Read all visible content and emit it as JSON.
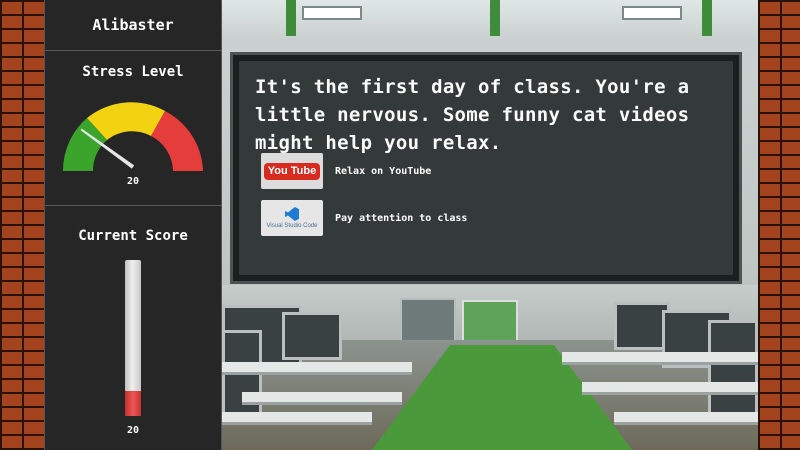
{
  "player": {
    "name": "Alibaster"
  },
  "stress": {
    "title": "Stress Level",
    "value": "20",
    "level_fraction": 0.2
  },
  "score": {
    "title": "Current Score",
    "value": "20",
    "fill_fraction": 0.16
  },
  "story": {
    "text": "It's the first day of class. You're a little nervous. Some funny cat videos might help you relax."
  },
  "choices": [
    {
      "label": "Relax on YouTube",
      "logo": "youtube-logo",
      "logo_text": "You Tube"
    },
    {
      "label": "Pay attention to class",
      "logo": "visual-studio-code-logo",
      "logo_text": "Visual Studio Code"
    }
  ],
  "colors": {
    "gauge_green": "#3aa42b",
    "gauge_yellow": "#f1d312",
    "gauge_red": "#e53c3c",
    "score_fill": "#e94a4a",
    "sidebar_bg": "#262626",
    "board_bg": "#343a39"
  }
}
